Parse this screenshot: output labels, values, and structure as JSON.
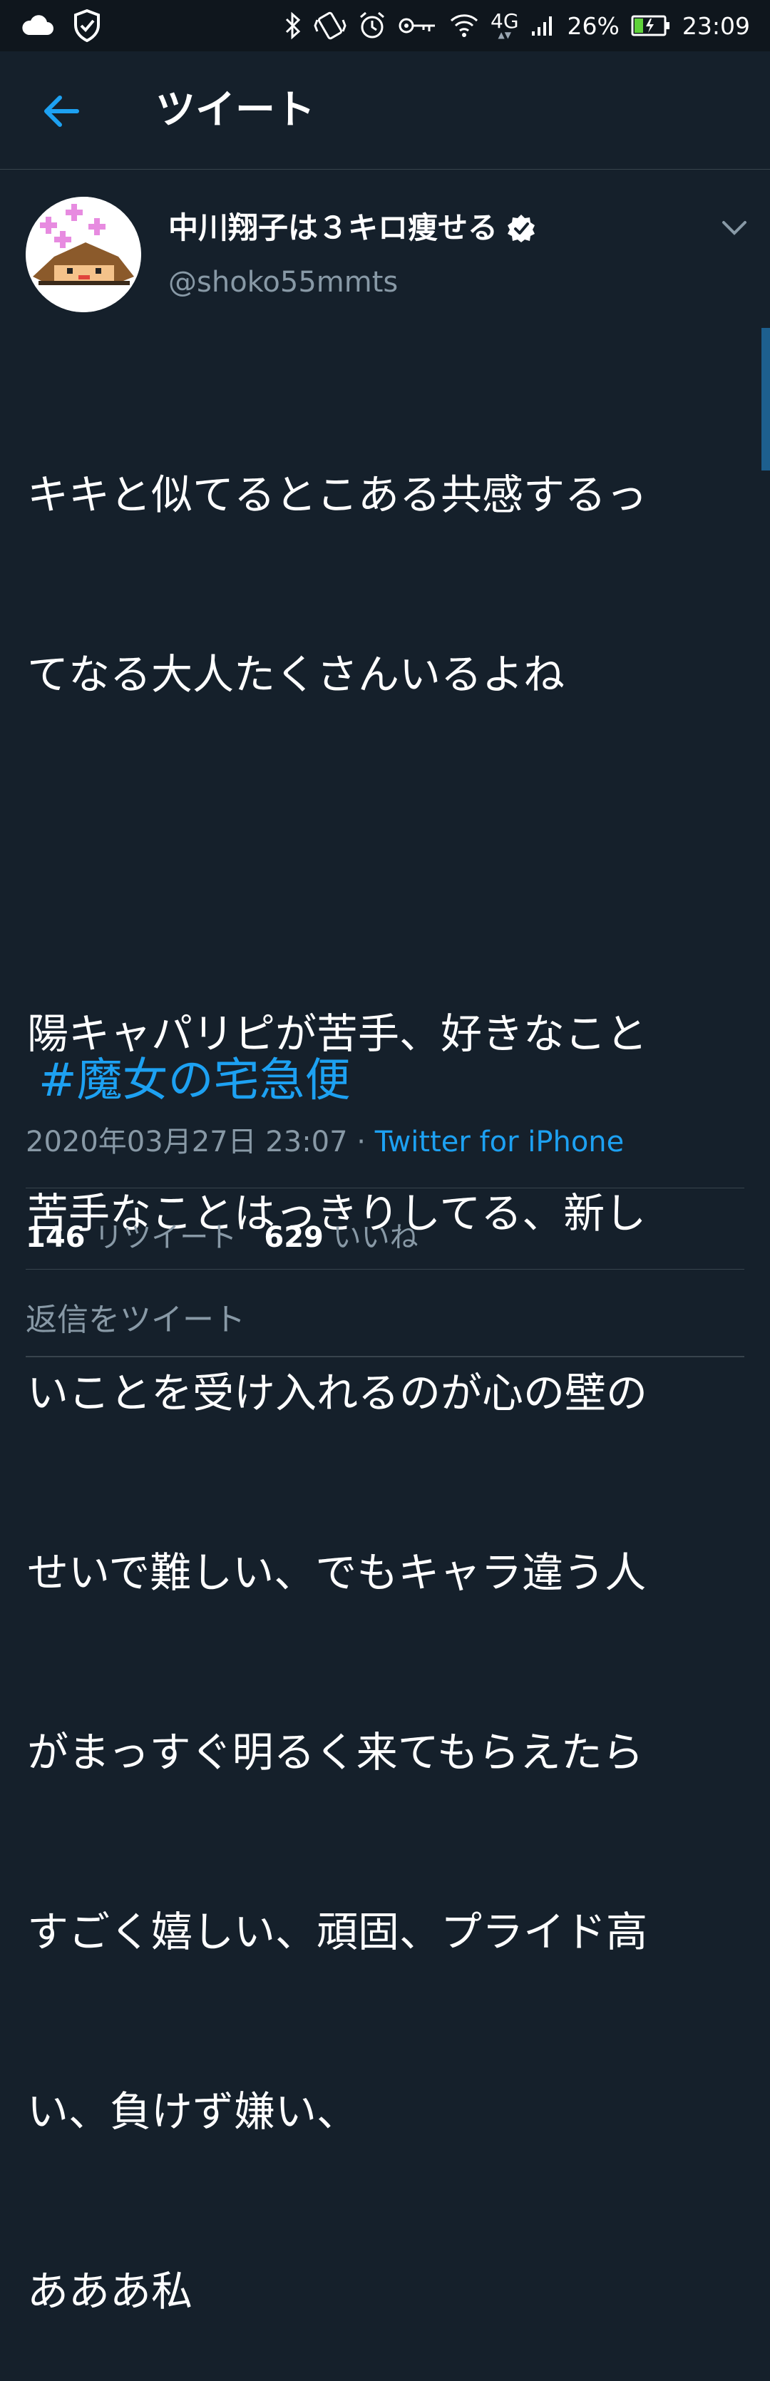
{
  "status_bar": {
    "network": "4G",
    "battery": "26%",
    "time": "23:09",
    "icons": [
      "cloud-icon",
      "shield-check-icon",
      "bluetooth-icon",
      "vibrate-icon",
      "alarm-icon",
      "key-icon",
      "wifi-icon",
      "signal-icon",
      "battery-charging-icon"
    ]
  },
  "header": {
    "title": "ツイート",
    "back_icon": "arrow-left-icon"
  },
  "tweet": {
    "author_name": "中川翔子は３キロ痩せる",
    "handle": "@shoko55mmts",
    "lines": [
      "キキと似てるとこある共感するっ",
      "てなる大人たくさんいるよね",
      "",
      "陽キャパリピが苦手、好きなこと",
      "苦手なことはっきりしてる、新し",
      "いことを受け入れるのが心の壁の",
      "せいで難しい、でもキャラ違う人",
      "がまっすぐ明るく来てもらえたら",
      "すごく嬉しい、頑固、プライド高",
      "い、負けず嫌い、",
      "あああ私"
    ],
    "hashtag": "#魔女の宅急便",
    "timestamp": "2020年03月27日 23:07",
    "separator": " · ",
    "source": "Twitter for iPhone",
    "retweet_count": "146",
    "retweet_label": "リツイート",
    "like_count": "629",
    "like_label": "いいね"
  },
  "reply": {
    "placeholder": "返信をツイート"
  },
  "colors": {
    "background": "#15202b",
    "accent": "#1da1f2",
    "muted": "#8899a6",
    "divider": "#38444d"
  }
}
